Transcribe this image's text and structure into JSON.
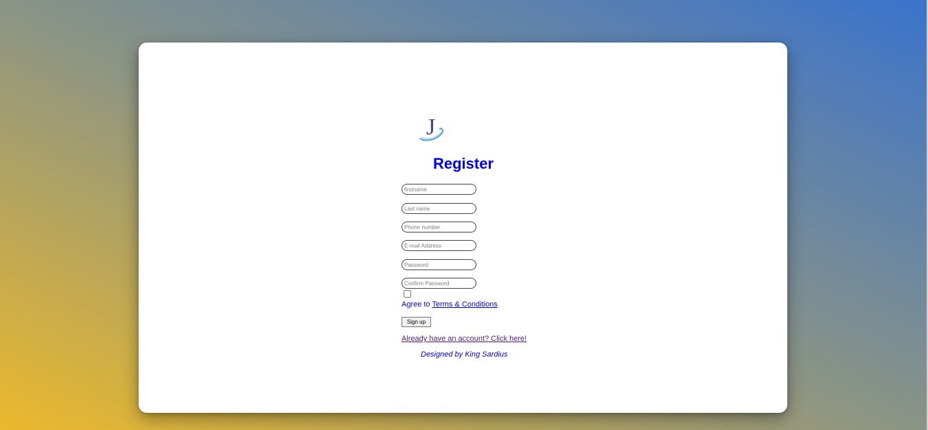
{
  "form": {
    "title": "Register",
    "logo_letter": "J",
    "fields": {
      "firstname": {
        "placeholder": "firstname",
        "value": ""
      },
      "lastname": {
        "placeholder": "Last name",
        "value": ""
      },
      "phone": {
        "placeholder": "Phone number",
        "value": ""
      },
      "email": {
        "placeholder": "E-mail Address",
        "value": ""
      },
      "password": {
        "placeholder": "Password",
        "value": ""
      },
      "confirm": {
        "placeholder": "Confirm Password",
        "value": ""
      }
    },
    "terms": {
      "checked": false,
      "agree_text": "Agree to ",
      "link_text": "Terms & Conditions"
    },
    "signup_label": "Sign up",
    "login_link": "Already have an account? Click here!",
    "credit": "Designed by King Sardius"
  },
  "colors": {
    "accent": "#0000ee",
    "visited_link": "#551a8b",
    "gradient_start": "#ebb92c",
    "gradient_end": "#3a73cc"
  }
}
